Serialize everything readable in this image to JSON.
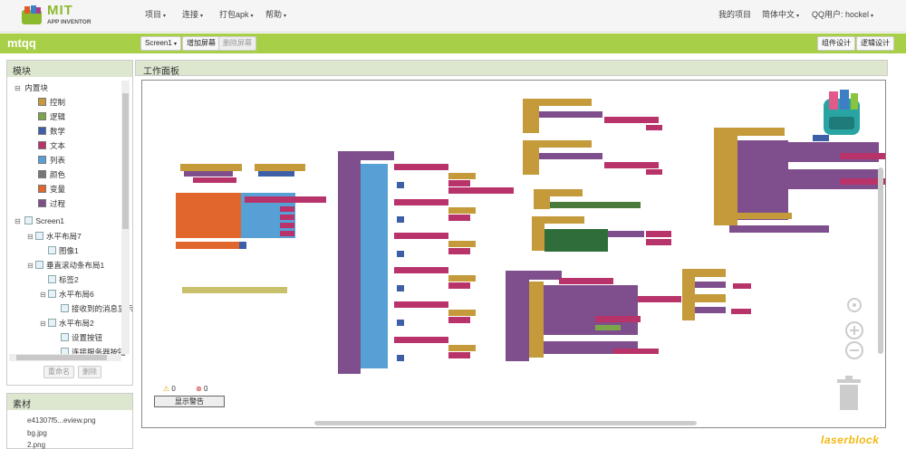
{
  "app": {
    "logo_title": "MIT",
    "logo_subtitle": "APP INVENTOR",
    "menus": [
      "项目",
      "连接",
      "打包apk",
      "帮助"
    ],
    "right_menu": {
      "my_projects": "我的项目",
      "language": "简体中文",
      "user": "QQ用户: hockel"
    }
  },
  "project": {
    "name": "mtqq",
    "screen_select": "Screen1",
    "add_screen": "增加屏幕",
    "remove_screen": "删除屏幕",
    "designer": "组件设计",
    "blocks": "逻辑设计"
  },
  "blocks_panel": {
    "title": "模块",
    "builtin": "内置块",
    "builtin_items": [
      {
        "label": "控制",
        "color": "#c49a3a"
      },
      {
        "label": "逻辑",
        "color": "#7ba54a"
      },
      {
        "label": "数学",
        "color": "#3d5fa8"
      },
      {
        "label": "文本",
        "color": "#b8336a"
      },
      {
        "label": "列表",
        "color": "#56a0d6"
      },
      {
        "label": "颜色",
        "color": "#777777"
      },
      {
        "label": "变量",
        "color": "#e0662c"
      },
      {
        "label": "过程",
        "color": "#7e4f8c"
      }
    ],
    "screen": "Screen1",
    "components": [
      {
        "label": "水平布局7",
        "depth": 1,
        "tog": "⊟"
      },
      {
        "label": "图像1",
        "depth": 2,
        "tog": ""
      },
      {
        "label": "垂直滚动条布局1",
        "depth": 1,
        "tog": "⊟"
      },
      {
        "label": "标签2",
        "depth": 2,
        "tog": ""
      },
      {
        "label": "水平布局6",
        "depth": 2,
        "tog": "⊟"
      },
      {
        "label": "接收到的消息显示",
        "depth": 3,
        "tog": ""
      },
      {
        "label": "水平布局2",
        "depth": 2,
        "tog": "⊟"
      },
      {
        "label": "设置按钮",
        "depth": 3,
        "tog": ""
      },
      {
        "label": "连接服务器按钮",
        "depth": 3,
        "tog": ""
      }
    ],
    "rename": "重命名",
    "delete": "删除"
  },
  "media_panel": {
    "title": "素材",
    "files": [
      "e41307f5...eview.png",
      "bg.jpg",
      "2.png"
    ]
  },
  "workspace": {
    "title": "工作面板",
    "warn_count": "0",
    "error_count": "0",
    "show_warnings": "显示警告"
  },
  "watermark": "laserblock",
  "colors": {
    "green_bar": "#a7cf47",
    "control": "#c49a3a",
    "procedure": "#7e4f8c",
    "list": "#56a0d6",
    "variable": "#e0662c",
    "text": "#b8336a",
    "math": "#3d5fa8",
    "component": "#4a7a3a"
  }
}
